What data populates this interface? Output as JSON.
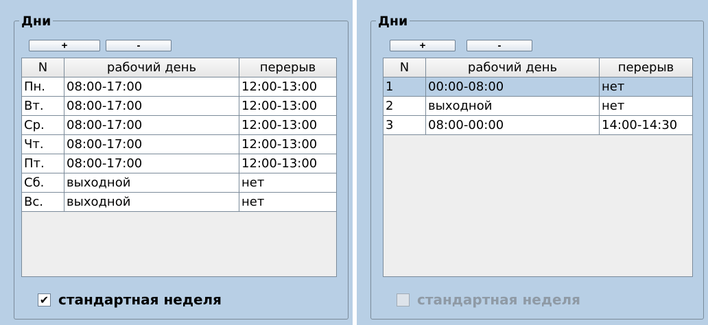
{
  "left_panel": {
    "group_title": "Дни",
    "add_button": "+",
    "remove_button": "-",
    "columns": [
      "N",
      "рабочий день",
      "перерыв"
    ],
    "rows": [
      {
        "n": "Пн.",
        "workday": "08:00-17:00",
        "break": "12:00-13:00"
      },
      {
        "n": "Вт.",
        "workday": "08:00-17:00",
        "break": "12:00-13:00"
      },
      {
        "n": "Ср.",
        "workday": "08:00-17:00",
        "break": "12:00-13:00"
      },
      {
        "n": "Чт.",
        "workday": "08:00-17:00",
        "break": "12:00-13:00"
      },
      {
        "n": "Пт.",
        "workday": "08:00-17:00",
        "break": "12:00-13:00"
      },
      {
        "n": "Сб.",
        "workday": "выходной",
        "break": "нет"
      },
      {
        "n": "Вс.",
        "workday": "выходной",
        "break": "нет"
      }
    ],
    "checkbox_label": "стандартная неделя",
    "checkbox_mark": "✔",
    "checkbox_checked": true,
    "checkbox_enabled": true
  },
  "right_panel": {
    "group_title": "Дни",
    "add_button": "+",
    "remove_button": "-",
    "columns": [
      "N",
      "рабочий день",
      "перерыв"
    ],
    "rows": [
      {
        "n": "1",
        "workday": "00:00-08:00",
        "break": "нет",
        "selected": true
      },
      {
        "n": "2",
        "workday": "выходной",
        "break": "нет"
      },
      {
        "n": "3",
        "workday": "08:00-00:00",
        "break": "14:00-14:30"
      }
    ],
    "checkbox_label": "стандартная неделя",
    "checkbox_mark": "",
    "checkbox_checked": false,
    "checkbox_enabled": false
  },
  "colors": {
    "panel_bg": "#b8cfe5",
    "selection": "#b8cfe5",
    "table_empty": "#eeeeee"
  }
}
